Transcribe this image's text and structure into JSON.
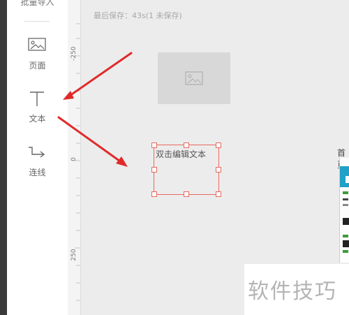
{
  "toolbar": {
    "batch_import": "批量导入",
    "tools": [
      {
        "label": "页面",
        "icon": "image-icon"
      },
      {
        "label": "文本",
        "icon": "text-t-icon"
      },
      {
        "label": "连线",
        "icon": "connector-line-icon"
      }
    ]
  },
  "ruler": {
    "labels": [
      "-250",
      "0",
      "250"
    ]
  },
  "canvas": {
    "save_status": "最后保存：43s(1 未保存)",
    "text_widget": "双击编辑文本",
    "page_tab": "首页"
  },
  "watermark": "软件技巧",
  "colors": {
    "selection": "#e8695f",
    "annotation_arrow": "#e02a2a",
    "thumbnail_accent": "#21a0c8",
    "thumbnail_green": "#3a9c3a"
  }
}
